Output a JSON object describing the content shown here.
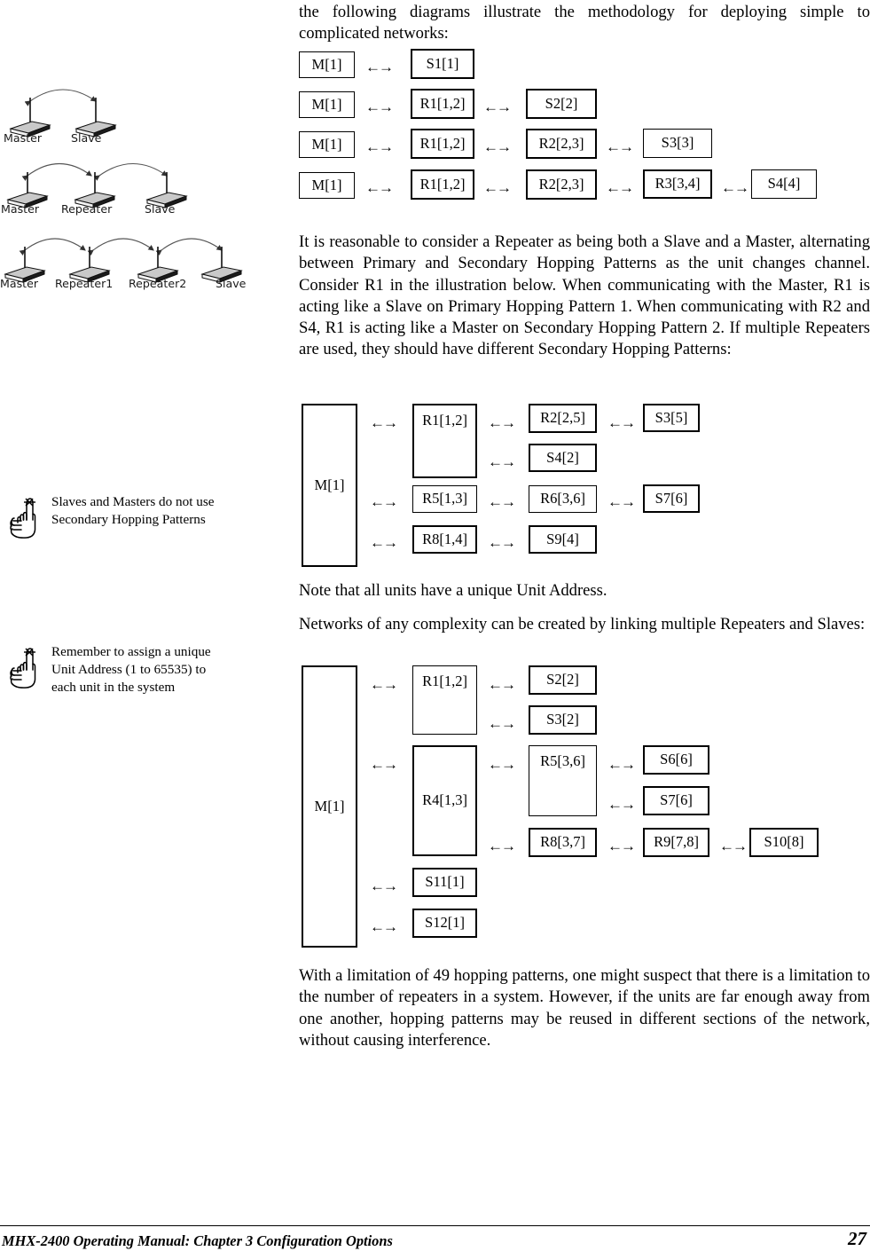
{
  "document": {
    "footer_text": "MHX-2400 Operating Manual: Chapter 3 Configuration Options",
    "page_number": "27"
  },
  "content": {
    "intro_paragraph": "the following diagrams illustrate the methodology for deploying simple to complicated networks:",
    "repeater_paragraph": "It is reasonable to consider a Repeater as being both a Slave and a Master, alternating between Primary and Secondary Hopping Patterns as the unit changes channel.  Consider R1 in the illustration below.  When communicating with the Master, R1 is acting like a Slave on Primary Hopping Pattern 1.  When communicating with R2 and S4, R1 is acting like a Master on Secondary Hopping Pattern 2.  If multiple Repeaters are used, they should have different Secondary Hopping Patterns:",
    "unit_address_note": "Note that all units have a unique Unit Address.",
    "complexity_paragraph": "Networks of any complexity can be created by linking multiple Repeaters and Slaves:",
    "limitation_paragraph": "With a limitation of 49 hopping patterns, one might suspect that there is a limitation to the number of repeaters in a system.  However, if the units are far enough away from one another, hopping patterns may be reused in different sections of the network, without causing interference."
  },
  "arrow_glyph": "←→",
  "diagram_simple": {
    "name": "simple-network-topologies",
    "rows": [
      {
        "nodes": [
          "M[1]",
          "S1[1]"
        ]
      },
      {
        "nodes": [
          "M[1]",
          "R1[1,2]",
          "S2[2]"
        ]
      },
      {
        "nodes": [
          "M[1]",
          "R1[1,2]",
          "R2[2,3]",
          "S3[3]"
        ]
      },
      {
        "nodes": [
          "M[1]",
          "R1[1,2]",
          "R2[2,3]",
          "R3[3,4]",
          "S4[4]"
        ]
      }
    ]
  },
  "diagram_secondary": {
    "name": "secondary-hopping-pattern-network",
    "master": "M[1]",
    "nodes": {
      "r1": "R1[1,2]",
      "r2": "R2[2,5]",
      "s3": "S3[5]",
      "s4": "S4[2]",
      "r5": "R5[1,3]",
      "r6": "R6[3,6]",
      "s7": "S7[6]",
      "r8": "R8[1,4]",
      "s9": "S9[4]"
    }
  },
  "diagram_complex": {
    "name": "complex-multi-repeater-network",
    "master": "M[1]",
    "nodes": {
      "r1": "R1[1,2]",
      "s2": "S2[2]",
      "s3": "S3[2]",
      "r4": "R4[1,3]",
      "r5": "R5[3,6]",
      "s6": "S6[6]",
      "s7": "S7[6]",
      "r8": "R8[3,7]",
      "r9": "R9[7,8]",
      "s10": "S10[8]",
      "s11": "S11[1]",
      "s12": "S12[1]"
    }
  },
  "sidebar": {
    "figures": [
      {
        "name": "master-slave-link",
        "labels": [
          "Master",
          "Slave"
        ]
      },
      {
        "name": "master-repeater-slave-link",
        "labels": [
          "Master",
          "Repeater",
          "Slave"
        ]
      },
      {
        "name": "master-two-repeaters-slave-link",
        "labels": [
          "Master",
          "Repeater1",
          "Repeater2",
          "Slave"
        ]
      }
    ],
    "notes": [
      {
        "name": "note-secondary-hopping",
        "text": "Slaves and Masters do not use Secondary Hopping Patterns"
      },
      {
        "name": "note-unit-address",
        "text": "Remember to assign a unique Unit Address (1 to 65535) to each unit in the system"
      }
    ]
  }
}
